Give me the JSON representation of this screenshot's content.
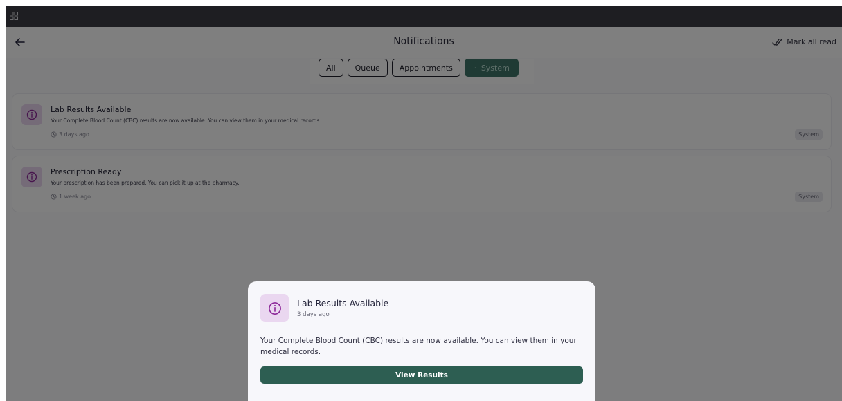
{
  "header": {
    "title": "Notifications",
    "mark_all_label": "Mark all read"
  },
  "tabs": [
    {
      "label": "All"
    },
    {
      "label": "Queue"
    },
    {
      "label": "Appointments"
    },
    {
      "label": "System"
    }
  ],
  "notifications": [
    {
      "title": "Lab Results Available",
      "message": "Your Complete Blood Count (CBC) results are now available. You can view them in your medical records.",
      "time": "3 days ago",
      "badge": "System"
    },
    {
      "title": "Prescription Ready",
      "message": "Your prescription has been prepared. You can pick it up at the pharmacy.",
      "time": "1 week ago",
      "badge": "System"
    }
  ],
  "sheet": {
    "title": "Lab Results Available",
    "time": "3 days ago",
    "message": "Your Complete Blood Count (CBC) results are now available. You can view them in your medical records.",
    "button_label": "View Results"
  },
  "icons": {
    "topbar": "grid-icon",
    "back": "arrow-left-icon",
    "mark_all": "double-check-icon",
    "tab_active": "check-icon",
    "notification": "info-circle-icon",
    "time": "clock-icon"
  },
  "colors": {
    "accent": "#2d5e52",
    "icon_bg": "#ead7f0",
    "icon_fg": "#8e2a9a",
    "topbar": "#3c3c44"
  }
}
